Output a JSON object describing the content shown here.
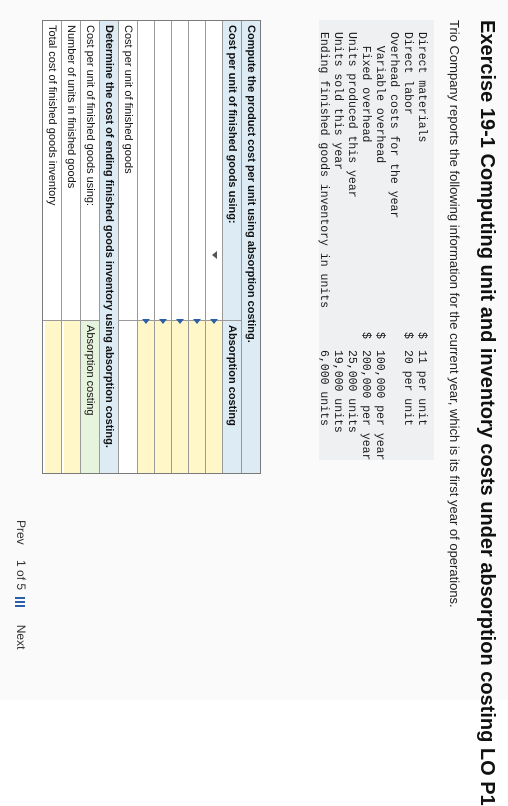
{
  "title": "Exercise 19-1 Computing unit and inventory costs under absorption costing LO P1",
  "intro": "Trio Company reports the following information for the current year, which is its first year of operations.",
  "info": [
    {
      "label": "Direct materials",
      "cur": "$",
      "value": "11 per unit"
    },
    {
      "label": "Direct labor",
      "cur": "$",
      "value": "20 per unit"
    },
    {
      "label": "Overhead costs for the year",
      "cur": "",
      "value": ""
    },
    {
      "label": "  Variable overhead",
      "cur": "$",
      "value": "100,000 per year"
    },
    {
      "label": "  Fixed overhead",
      "cur": "$",
      "value": "200,000 per year"
    },
    {
      "label": "Units produced this year",
      "cur": "",
      "value": "25,000 units"
    },
    {
      "label": "Units sold this year",
      "cur": "",
      "value": "19,000 units"
    },
    {
      "label": "Ending finished goods inventory in units",
      "cur": "",
      "value": "6,000 units"
    }
  ],
  "table": {
    "header": "Compute the product cost per unit using absorption costing.",
    "sub_left": "Cost per unit of finished goods using:",
    "sub_right": "Absorption costing",
    "row_total": "Cost per unit of finished goods",
    "section2": "Determine the cost of ending finished goods inventory using absorption costing.",
    "row_cpu": "Cost per unit of finished goods using:",
    "row_cpu_right": "Absorption costing",
    "row_units": "Number of units in finished goods",
    "row_total_inv": "Total cost of finished goods inventory"
  },
  "footer": {
    "prev": "Prev",
    "page": "1 of 5",
    "next": "Next"
  }
}
